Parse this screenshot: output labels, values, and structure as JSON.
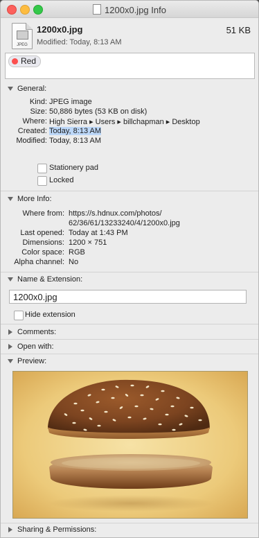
{
  "window": {
    "title": "1200x0.jpg Info"
  },
  "header": {
    "file_name": "1200x0.jpg",
    "file_size": "51 KB",
    "modified": "Modified: Today, 8:13 AM",
    "icon_label": "JPEG"
  },
  "tags": {
    "items": [
      {
        "label": "Red",
        "color": "#fc4f4e"
      }
    ]
  },
  "general": {
    "title": "General:",
    "rows": [
      {
        "key": "Kind:",
        "value": "JPEG image"
      },
      {
        "key": "Size:",
        "value": "50,886 bytes (53 KB on disk)"
      },
      {
        "key": "Where:",
        "value": "High Sierra ▸ Users ▸ billchapman ▸ Desktop"
      },
      {
        "key": "Created:",
        "value": "Today, 8:13 AM"
      },
      {
        "key": "Modified:",
        "value": "Today, 8:13 AM"
      }
    ],
    "stationery_label": "Stationery pad",
    "stationery_checked": false,
    "locked_label": "Locked",
    "locked_checked": false
  },
  "more_info": {
    "title": "More Info:",
    "where_from_key": "Where from:",
    "where_from_line1": "https://s.hdnux.com/photos/",
    "where_from_line2": "62/36/61/13233240/4/1200x0.jpg",
    "rows": [
      {
        "key": "Last opened:",
        "value": "Today at 1:43 PM"
      },
      {
        "key": "Dimensions:",
        "value": "1200 × 751"
      },
      {
        "key": "Color space:",
        "value": "RGB"
      },
      {
        "key": "Alpha channel:",
        "value": "No"
      }
    ]
  },
  "name_extension": {
    "title": "Name & Extension:",
    "name_value": "1200x0.jpg",
    "hide_extension_label": "Hide extension",
    "hide_extension_checked": false
  },
  "comments": {
    "title": "Comments:"
  },
  "open_with": {
    "title": "Open with:"
  },
  "preview": {
    "title": "Preview:"
  },
  "sharing": {
    "title": "Sharing & Permissions:"
  },
  "colors": {
    "selection": "#bcd7f8",
    "window_bg": "#ececec",
    "tag_red": "#fc4f4e"
  }
}
